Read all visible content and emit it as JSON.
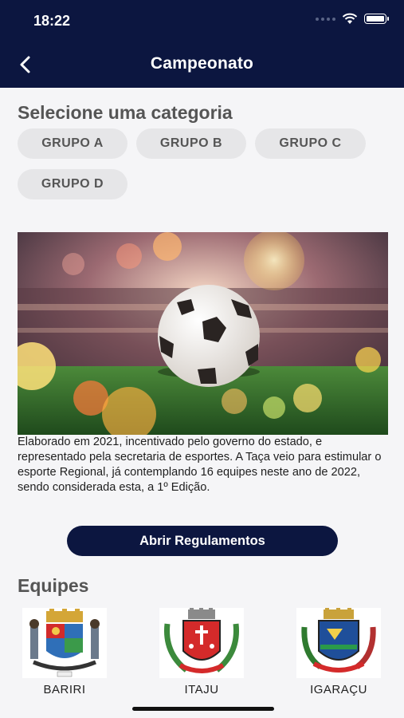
{
  "status": {
    "time": "18:22"
  },
  "header": {
    "title": "Campeonato"
  },
  "categories": {
    "heading": "Selecione uma categoria",
    "items": [
      "GRUPO A",
      "GRUPO B",
      "GRUPO C",
      "GRUPO D"
    ]
  },
  "description": "Elaborado em 2021, incentivado pelo governo do estado, e representado pela secretaria de esportes. A Taça veio para estimular o esporte Regional, já contemplando 16 equipes neste ano de 2022, sendo considerada esta, a 1º Edição.",
  "regulations_button": "Abrir Regulamentos",
  "teams": {
    "heading": "Equipes",
    "items": [
      {
        "name": "BARIRI",
        "crest": "bariri-crest"
      },
      {
        "name": "ITAJU",
        "crest": "itaju-crest"
      },
      {
        "name": "IGARAÇU",
        "crest": "igaracu-crest"
      }
    ]
  },
  "colors": {
    "navy": "#0c1640",
    "chip_bg": "#e6e6e8",
    "text_gray": "#555555"
  }
}
